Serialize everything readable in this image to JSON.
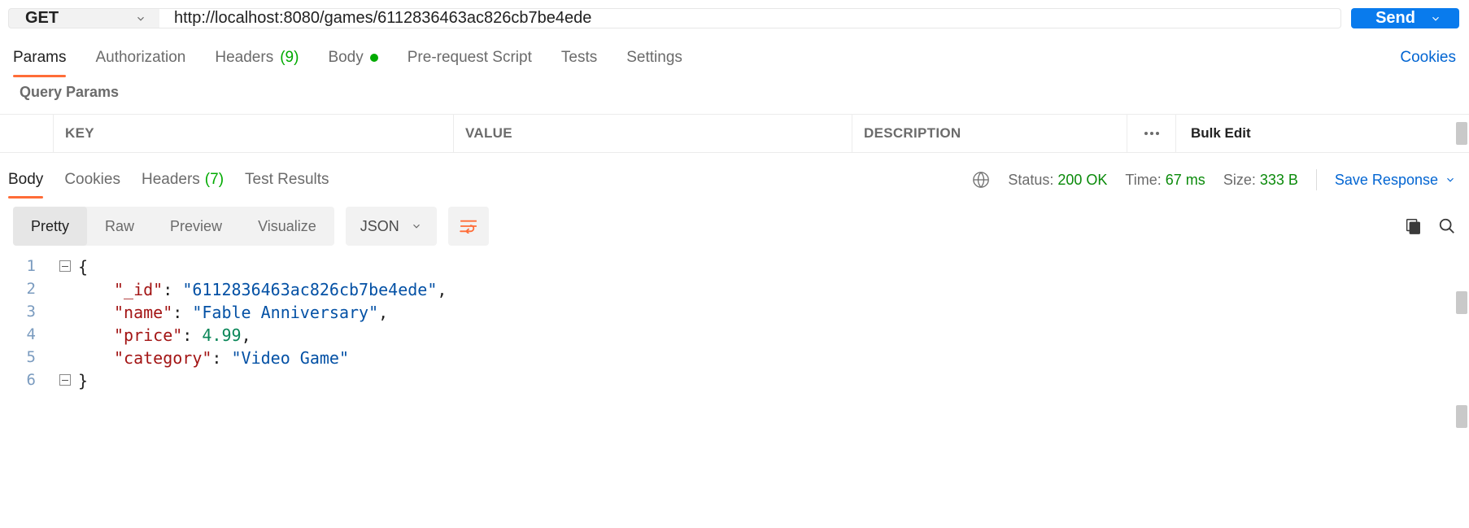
{
  "request": {
    "method": "GET",
    "url": "http://localhost:8080/games/6112836463ac826cb7be4ede",
    "send_label": "Send"
  },
  "request_tabs": {
    "params": "Params",
    "authorization": "Authorization",
    "headers": "Headers",
    "headers_count": "(9)",
    "body": "Body",
    "pre_request": "Pre-request Script",
    "tests": "Tests",
    "settings": "Settings",
    "cookies_link": "Cookies"
  },
  "query_params": {
    "title": "Query Params",
    "columns": {
      "key": "KEY",
      "value": "VALUE",
      "description": "DESCRIPTION"
    },
    "bulk_edit": "Bulk Edit"
  },
  "response_tabs": {
    "body": "Body",
    "cookies": "Cookies",
    "headers": "Headers",
    "headers_count": "(7)",
    "test_results": "Test Results"
  },
  "response_meta": {
    "status_label": "Status:",
    "status_value": "200 OK",
    "time_label": "Time:",
    "time_value": "67 ms",
    "size_label": "Size:",
    "size_value": "333 B",
    "save_response": "Save Response"
  },
  "body_toolbar": {
    "pretty": "Pretty",
    "raw": "Raw",
    "preview": "Preview",
    "visualize": "Visualize",
    "format": "JSON"
  },
  "response_body": {
    "lines": [
      {
        "n": "1"
      },
      {
        "n": "2",
        "key": "\"_id\"",
        "value": "\"6112836463ac826cb7be4ede\"",
        "type": "str",
        "comma": ","
      },
      {
        "n": "3",
        "key": "\"name\"",
        "value": "\"Fable Anniversary\"",
        "type": "str",
        "comma": ","
      },
      {
        "n": "4",
        "key": "\"price\"",
        "value": "4.99",
        "type": "num",
        "comma": ","
      },
      {
        "n": "5",
        "key": "\"category\"",
        "value": "\"Video Game\"",
        "type": "str",
        "comma": ""
      },
      {
        "n": "6"
      }
    ]
  }
}
